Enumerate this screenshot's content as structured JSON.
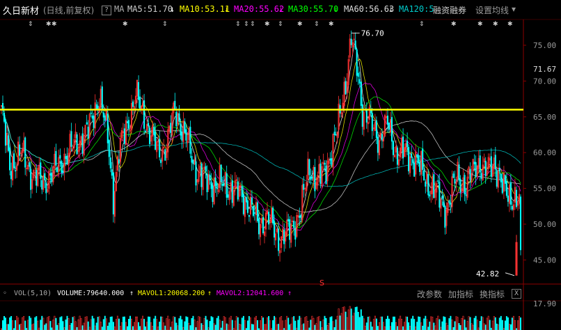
{
  "header": {
    "stock_name": "久日新材",
    "period_label": "(日线,前复权)",
    "help_icon": "?",
    "ma_label": "MA",
    "ma_items": [
      {
        "label": "MA5:51.70",
        "arrow": "↓",
        "color": "#ffffff"
      },
      {
        "label": "MA10:53.11",
        "arrow": "↓",
        "color": "#ffff00"
      },
      {
        "label": "MA20:55.62",
        "arrow": "↓",
        "color": "#ff00ff"
      },
      {
        "label": "MA30:55.70",
        "arrow": "↓",
        "color": "#00ff00"
      },
      {
        "label": "MA60:56.63",
        "arrow": "↓",
        "color": "#dddddd"
      },
      {
        "label": "MA120:5",
        "arrow": "",
        "color": "#00cccc"
      }
    ],
    "margin_label": "融资融券",
    "settings_label": "设置均线",
    "settings_arrow": "▾"
  },
  "price_axis": {
    "ticks": [
      "75.00",
      "70.00",
      "65.00",
      "60.00",
      "55.00",
      "50.00",
      "45.00"
    ],
    "current_price": "71.67"
  },
  "annotations": {
    "high_label": "76.70",
    "low_label": "42.82",
    "marker": "S"
  },
  "volume_panel": {
    "indicator": "VOL(5,10)",
    "volume": "VOLUME:79640.000",
    "volume_arrow": "↑",
    "mavol1": "MAVOL1:20068.200",
    "mavol1_arrow": "↑",
    "mavol2": "MAVOL2:12041.600",
    "mavol2_arrow": "↑",
    "change_params": "改参数",
    "add_indicator": "加指标",
    "switch_indicator": "换指标",
    "close": "X",
    "axis_tick": "17.90"
  },
  "chart_data": {
    "type": "candlestick",
    "ylim": [
      42,
      78
    ],
    "price_ticks": [
      75,
      70,
      65,
      60,
      55,
      50,
      45
    ],
    "horizontal_line": 66.0,
    "high": 76.7,
    "low": 42.82,
    "last_close": 43.5,
    "colors": {
      "up": "#ff3232",
      "down": "#00ffff",
      "hline": "#ffff00"
    }
  }
}
